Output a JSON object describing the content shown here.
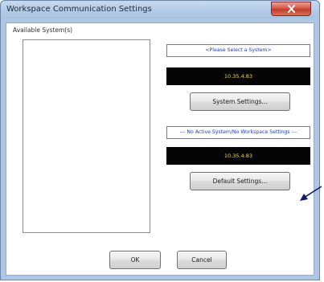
{
  "window": {
    "title": "Workspace Communication Settings"
  },
  "available_systems": {
    "label": "Available System(s)",
    "items": []
  },
  "system_panel": {
    "status_text": "<Please Select a System>",
    "ip_address": "10.35.4.83",
    "button_label": "System Settings..."
  },
  "workspace_panel": {
    "status_text": "--- No Active System/No Workspace Settings ---",
    "ip_address": "10.35.4.83",
    "button_label": "Default Settings..."
  },
  "footer": {
    "ok_label": "OK",
    "cancel_label": "Cancel"
  },
  "colors": {
    "status_text": "#1a3fc4",
    "ip_text": "#e8d85a",
    "ip_background": "#050505",
    "close_button": "#c94a36",
    "annotation_arrow": "#0d1a6b"
  },
  "icons": {
    "close": "close-icon",
    "annotation": "arrow-icon"
  }
}
